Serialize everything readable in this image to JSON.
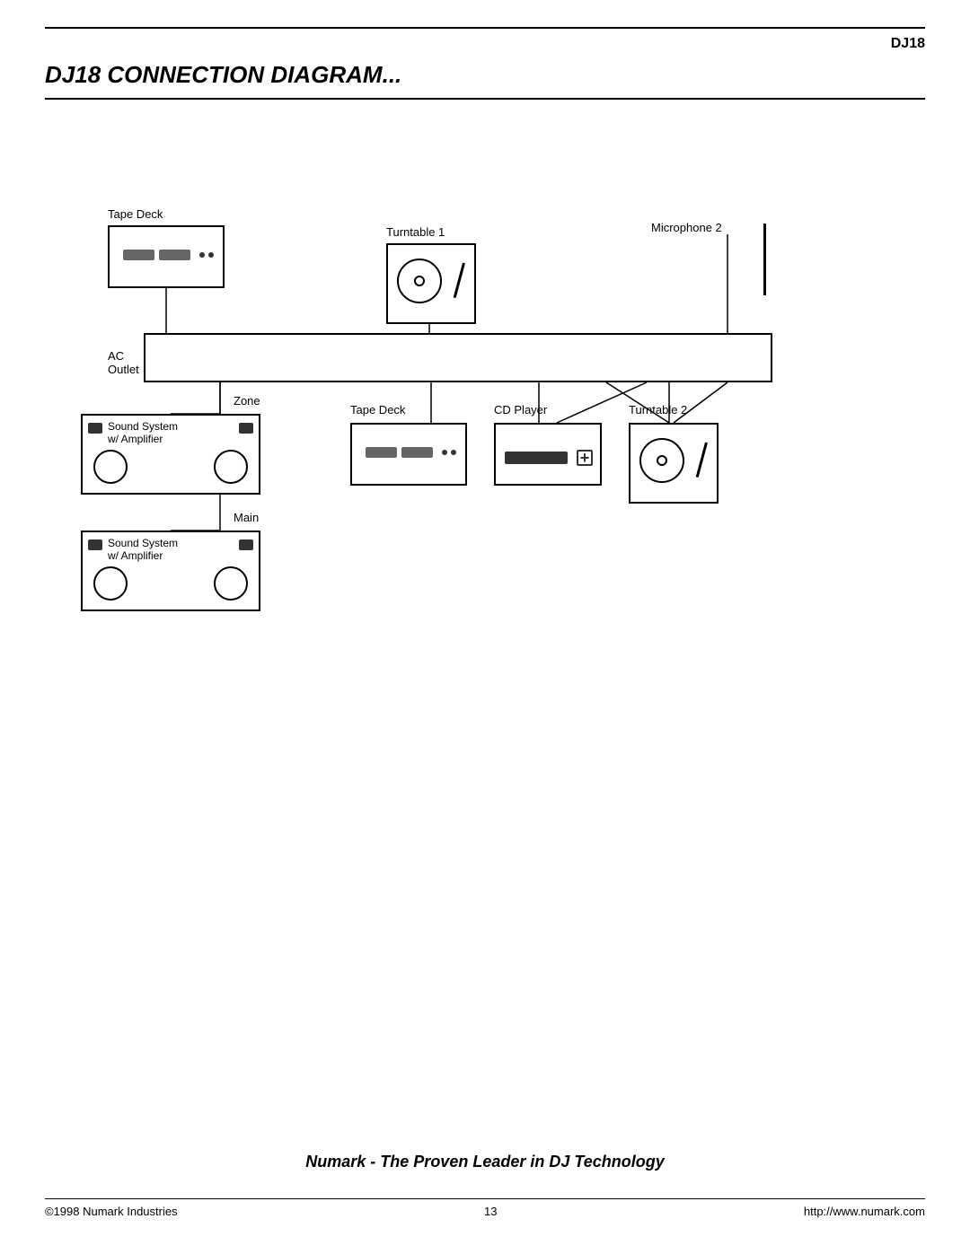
{
  "header": {
    "brand": "DJ18",
    "title": "DJ18 CONNECTION DIAGRAM..."
  },
  "devices": {
    "tape_deck_1": {
      "label": "Tape Deck"
    },
    "turntable_1": {
      "label": "Turntable 1"
    },
    "turntable_2": {
      "label": "Turntable 2"
    },
    "microphone_2": {
      "label": "Microphone 2"
    },
    "tape_deck_2": {
      "label": "Tape Deck"
    },
    "cd_player": {
      "label": "CD Player"
    },
    "ac_outlet": {
      "label": "AC\nOutlet"
    },
    "zone_label": {
      "label": "Zone"
    },
    "main_label": {
      "label": "Main"
    },
    "sound_system_zone": {
      "line1": "Sound System",
      "line2": "w/ Amplifier"
    },
    "sound_system_main": {
      "line1": "Sound System",
      "line2": "w/ Amplifier"
    }
  },
  "footer": {
    "tagline": "Numark - The Proven Leader in DJ Technology",
    "copyright": "©1998 Numark Industries",
    "page_number": "13",
    "website": "http://www.numark.com"
  }
}
